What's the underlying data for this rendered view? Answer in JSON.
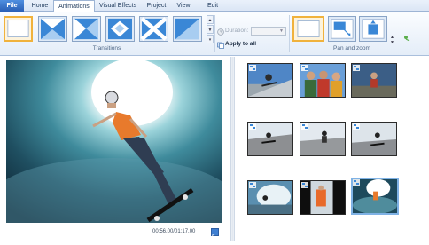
{
  "tabs": [
    {
      "label": "File"
    },
    {
      "label": "Home"
    },
    {
      "label": "Animations"
    },
    {
      "label": "Visual Effects"
    },
    {
      "label": "Project"
    },
    {
      "label": "View"
    },
    {
      "label": "Edit"
    }
  ],
  "ribbon": {
    "transitions_group": "Transitions",
    "duration_label": "Duration:",
    "apply_label": "Apply to all",
    "panzoom_group": "Pan and zoom"
  },
  "preview": {
    "timecode": "00:56.00/01:17.00"
  },
  "storyboard": {
    "clip_count": 9,
    "selected_clip": 9
  },
  "colors": {
    "accent": "#f0b23c",
    "ribbon_border": "#a9bfdc",
    "tab_file": "#2a5fb5",
    "selection": "#7fb2e5"
  }
}
